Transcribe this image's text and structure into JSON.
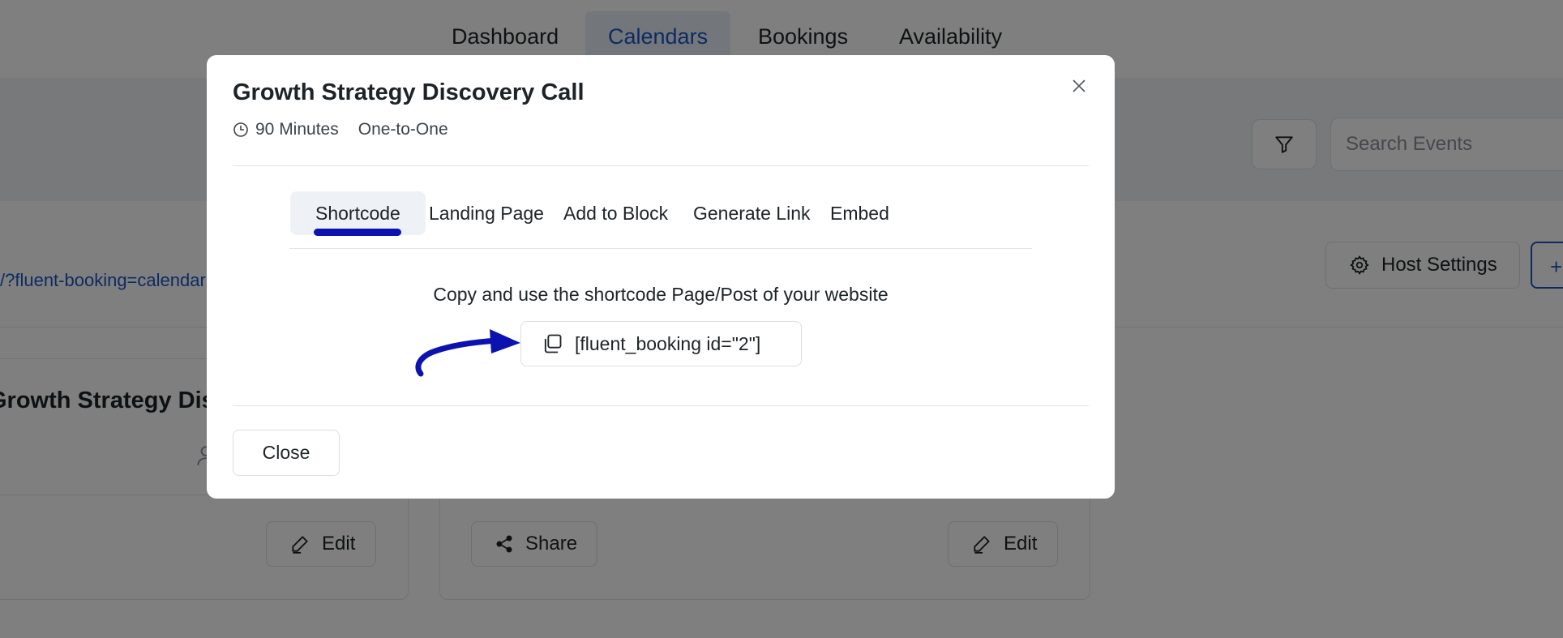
{
  "nav": {
    "items": [
      {
        "label": "Dashboard",
        "active": false
      },
      {
        "label": "Calendars",
        "active": true
      },
      {
        "label": "Bookings",
        "active": false
      },
      {
        "label": "Availability",
        "active": false
      }
    ]
  },
  "toolbar": {
    "search_placeholder": "Search Events",
    "host_settings_label": "Host Settings",
    "add_label": "+"
  },
  "page": {
    "calendar_link": "/?fluent-booking=calendar"
  },
  "cards": {
    "left_title": "Growth Strategy Discovery Call",
    "edit_label": "Edit",
    "share_label": "Share"
  },
  "modal": {
    "title": "Growth Strategy Discovery Call",
    "duration": "90 Minutes",
    "event_type": "One-to-One",
    "tabs": [
      {
        "label": "Shortcode",
        "active": true
      },
      {
        "label": "Landing Page",
        "active": false
      },
      {
        "label": "Add to Block",
        "active": false
      },
      {
        "label": "Generate Link",
        "active": false
      },
      {
        "label": "Embed",
        "active": false
      }
    ],
    "instruction": "Copy and use the shortcode Page/Post of your website",
    "shortcode": "[fluent_booking id=\"2\"]",
    "close_label": "Close"
  },
  "colors": {
    "accent": "#1a56c4",
    "tab_underline": "#0b12b0",
    "annotation_arrow": "#0b12b0",
    "overlay": "rgba(0,0,0,0.5)"
  }
}
